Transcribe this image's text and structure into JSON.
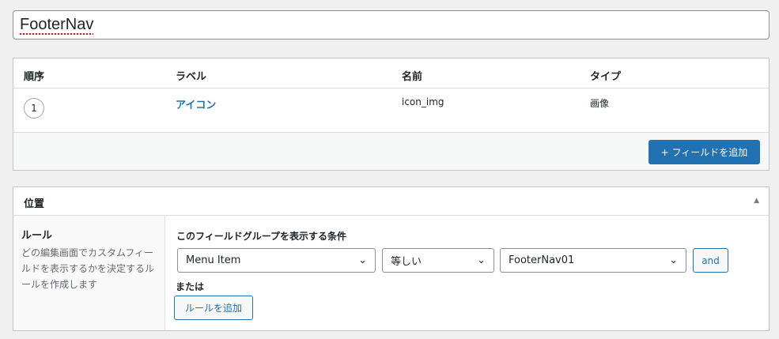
{
  "title_input": {
    "value": "FooterNav"
  },
  "fields_table": {
    "headers": [
      "順序",
      "ラベル",
      "名前",
      "タイプ"
    ],
    "rows": [
      {
        "order": "1",
        "label": "アイコン",
        "name": "icon_img",
        "type": "画像"
      }
    ],
    "add_field_label": "+ フィールドを追加"
  },
  "location": {
    "title": "位置",
    "collapse_icon": "▲",
    "rules_heading": "ルール",
    "rules_desc": "どの編集画面でカスタムフィールドを表示するかを決定するルールを作成します",
    "condition_heading": "このフィールドグループを表示する条件",
    "param": "Menu Item",
    "operator": "等しい",
    "value": "FooterNav01",
    "and_label": "and",
    "or_label": "または",
    "add_rule_label": "ルールを追加"
  }
}
